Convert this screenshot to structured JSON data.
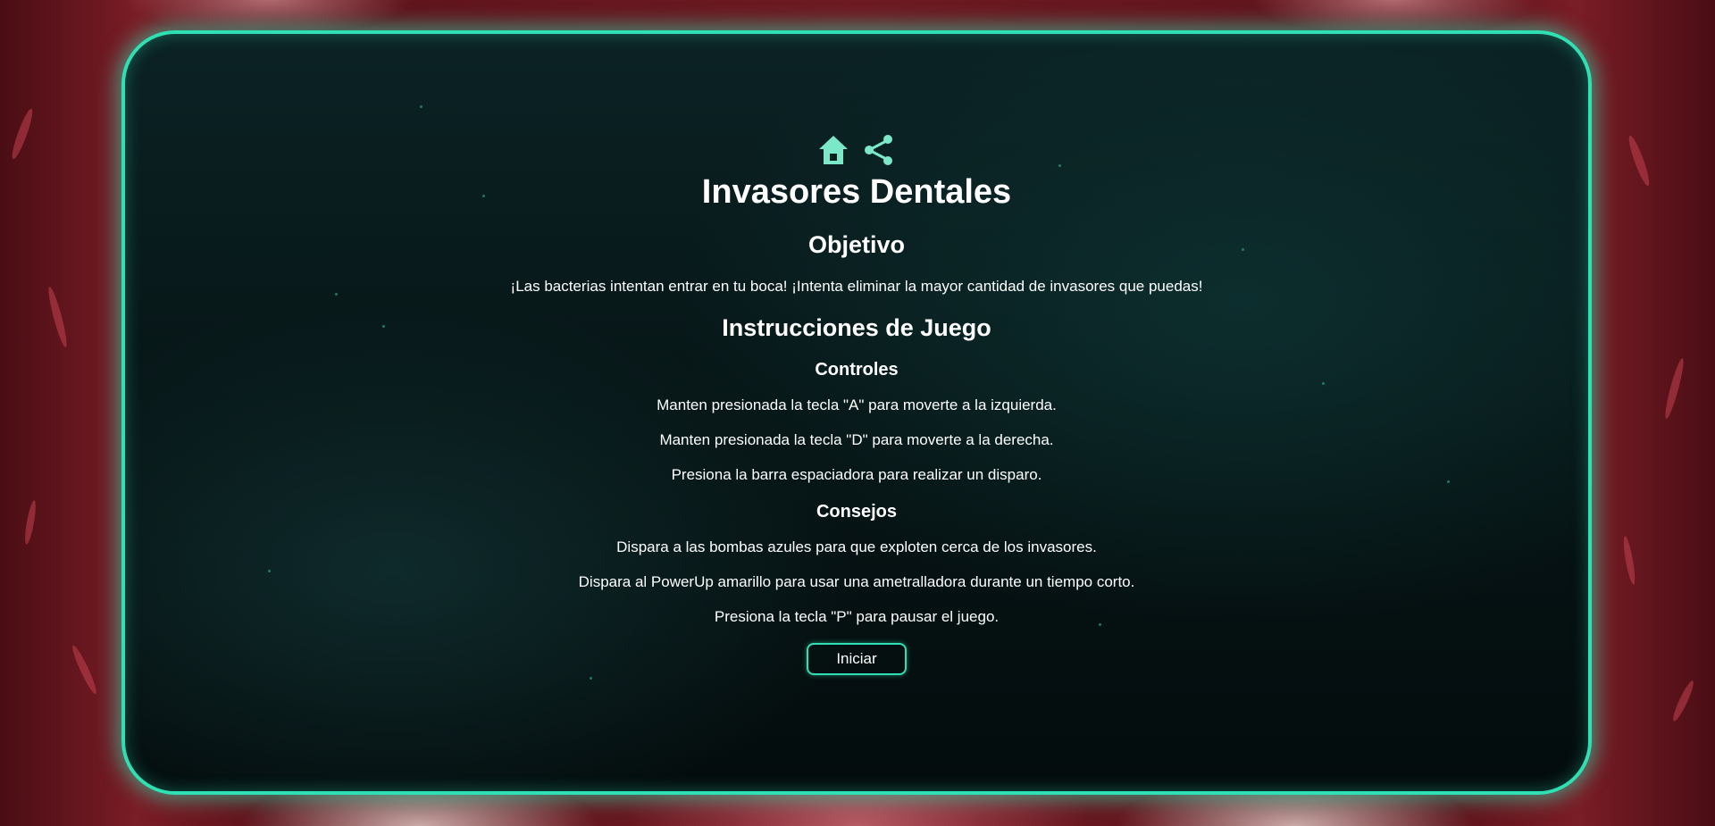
{
  "title": "Invasores Dentales",
  "icons": {
    "home": "home-icon",
    "share": "share-icon",
    "accent_color": "#7be8c8"
  },
  "objective": {
    "heading": "Objetivo",
    "text": "¡Las bacterias intentan entrar en tu boca! ¡Intenta eliminar la mayor cantidad de invasores que puedas!"
  },
  "instructions": {
    "heading": "Instrucciones de Juego",
    "controls": {
      "heading": "Controles",
      "lines": [
        "Manten presionada la tecla \"A\" para moverte a la izquierda.",
        "Manten presionada la tecla \"D\" para moverte a la derecha.",
        "Presiona la barra espaciadora para realizar un disparo."
      ]
    },
    "tips": {
      "heading": "Consejos",
      "lines": [
        "Dispara a las bombas azules para que exploten cerca de los invasores.",
        "Dispara al PowerUp amarillo para usar una ametralladora durante un tiempo corto.",
        "Presiona la tecla \"P\" para pausar el juego."
      ]
    }
  },
  "start_button": {
    "label": "Iniciar"
  },
  "colors": {
    "panel_border": "#2fe0b4",
    "text": "#ffffff",
    "background": "#6e1a22"
  }
}
